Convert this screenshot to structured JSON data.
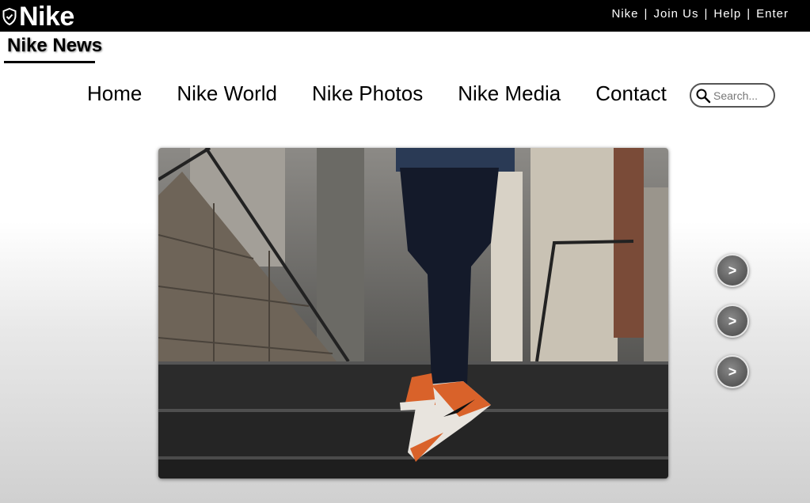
{
  "brand": {
    "name": "Nike",
    "logo_icon": "shield-icon"
  },
  "top_links": [
    "Nike",
    "Join Us",
    "Help",
    "Enter"
  ],
  "top_separator": "|",
  "section_title": "Nike News",
  "nav": [
    "Home",
    "Nike World",
    "Nike Photos",
    "Nike Media",
    "Contact"
  ],
  "search": {
    "placeholder": "Search...",
    "value": "",
    "icon": "search-icon"
  },
  "hero": {
    "subject": "person wearing orange and white sneakers on concrete stairs"
  },
  "slider_buttons": [
    ">",
    ">",
    ">"
  ]
}
